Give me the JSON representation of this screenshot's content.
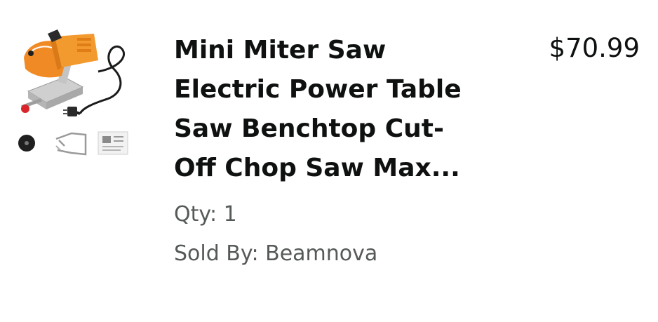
{
  "item": {
    "title_lines": [
      "Mini Miter Saw",
      "Electric Power Table",
      "Saw Benchtop Cut-",
      "Off Chop Saw Max..."
    ],
    "quantity_label": "Qty:",
    "quantity": "1",
    "seller_label": "Sold By:",
    "seller": "Beamnova",
    "price": "$70.99",
    "image_icon": "miter-saw-product-image",
    "accent_color": "#f08a24"
  }
}
